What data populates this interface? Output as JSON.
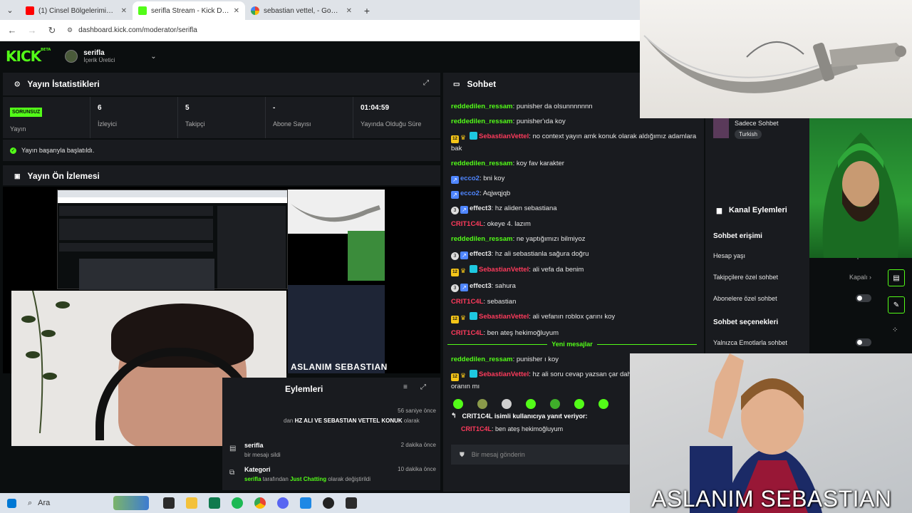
{
  "browser": {
    "tabs": [
      {
        "label": "(1) Cinsel Bölgelerimiz Neden K",
        "active": false
      },
      {
        "label": "serifla Stream - Kick Dashboard",
        "active": true
      },
      {
        "label": "sebastian vettel, - Google'da Ar",
        "active": false
      }
    ],
    "new_tab": "+",
    "url": "dashboard.kick.com/moderator/serifla"
  },
  "kick": {
    "logo": "KICK",
    "logo_badge": "BETA",
    "user_name": "serifla",
    "user_role": "İçerik Üretici"
  },
  "stats_panel": {
    "title": "Yayın İstatistikleri",
    "items": [
      {
        "value": "SORUNSUZ",
        "label": "Yayın"
      },
      {
        "value": "6",
        "label": "İzleyici"
      },
      {
        "value": "5",
        "label": "Takipçi"
      },
      {
        "value": "-",
        "label": "Abone Sayısı"
      },
      {
        "value": "01:04:59",
        "label": "Yayında Olduğu Süre"
      }
    ],
    "status_message": "Yayın başarıyla başlatıldı."
  },
  "preview_panel": {
    "title": "Yayın Ön İzlemesi",
    "caption": "ASLANIM SEBASTIAN"
  },
  "actions_panel": {
    "title": "Eylemleri",
    "rows": [
      {
        "title_pre": "dan ",
        "title_bold": "HZ ALI VE SEBASTIAN VETTEL KONUK",
        "title_post": " olarak",
        "sub": "",
        "time": "56 saniye önce"
      },
      {
        "title": "serifla",
        "sub": "bir mesajı sildi",
        "time": "2 dakika önce"
      },
      {
        "title": "Kategori",
        "sub_user": "serifla",
        "sub_mid": " tarafından ",
        "sub_cat": "Just Chatting",
        "sub_post": " olarak değiştirildi",
        "time": "10 dakika önce"
      }
    ]
  },
  "chat": {
    "title": "Sohbet",
    "messages": [
      {
        "user": "reddedilen_ressam",
        "color": "green",
        "badges": [],
        "text": "punisher da olsunnnnnnn"
      },
      {
        "user": "reddedilen_ressam",
        "color": "green",
        "badges": [],
        "text": "punisher'ıda koy"
      },
      {
        "user": "SebastianVettel",
        "color": "red",
        "badges": [
          "sub",
          "crown",
          "vip"
        ],
        "text": "no context yayın amk konuk olarak aldığımız adamlara bak"
      },
      {
        "user": "reddedilen_ressam",
        "color": "green",
        "badges": [],
        "text": "koy fav karakter"
      },
      {
        "user": "ecco2",
        "color": "blue",
        "badges": [
          "arrow"
        ],
        "text": "bni koy"
      },
      {
        "user": "ecco2",
        "color": "blue",
        "badges": [
          "arrow"
        ],
        "text": "Aqjwqjqb"
      },
      {
        "user": "effect3",
        "color": "white",
        "badges": [
          "circle",
          "arrow"
        ],
        "text": "hz aliden sebastiana"
      },
      {
        "user": "CRIT1C4L",
        "color": "red",
        "badges": [],
        "text": "okeye 4. lazım"
      },
      {
        "user": "reddedilen_ressam",
        "color": "green",
        "badges": [],
        "text": "ne yaptığımızı bilmiyoz"
      },
      {
        "user": "effect3",
        "color": "white",
        "badges": [
          "circle",
          "arrow"
        ],
        "text": "hz ali sebastianla sağura doğru"
      },
      {
        "user": "SebastianVettel",
        "color": "red",
        "badges": [
          "sub",
          "crown",
          "vip"
        ],
        "text": "ali vefa da benim"
      },
      {
        "user": "effect3",
        "color": "white",
        "badges": [
          "circle",
          "arrow"
        ],
        "text": "sahura"
      },
      {
        "user": "CRIT1C4L",
        "color": "red",
        "badges": [],
        "text": "sebastian"
      },
      {
        "user": "SebastianVettel",
        "color": "red",
        "badges": [
          "sub",
          "crown",
          "vip"
        ],
        "text": "ali vefanın roblox çarını koy"
      },
      {
        "user": "CRIT1C4L",
        "color": "red",
        "badges": [],
        "text": "ben ateş hekimoğluyum"
      }
    ],
    "new_messages_label": "Yeni mesajlar",
    "after_messages": [
      {
        "user": "reddedilen_ressam",
        "color": "green",
        "badges": [],
        "text": "punisher ı koy"
      },
      {
        "user": "SebastianVettel",
        "color": "red",
        "badges": [
          "sub",
          "crown",
          "vip"
        ],
        "text": "hz ali soru cevap yazsan çar daha yüksek ban yeme oranın mı"
      }
    ],
    "reply_header": "CRIT1C4L isimli kullanıcıya yanıt veriyor:",
    "reply_user": "CRIT1C4L",
    "reply_text": "ben ateş hekimoğluyum",
    "input_placeholder": "Bir mesaj gönderin"
  },
  "channel_panel": {
    "mode_title": "Sadece Sohbet",
    "mode_lang": "Turkish",
    "title": "Kanal Eylemleri",
    "access_title": "Sohbet erişimi",
    "settings": [
      {
        "label": "Hesap yaşı",
        "value": "Kapalı"
      },
      {
        "label": "Takipçilere özel sohbet",
        "value": "Kapalı"
      },
      {
        "label": "Abonelere özel sohbet",
        "value": ""
      }
    ],
    "options_title": "Sohbet seçenekleri",
    "options": [
      {
        "label": "Yalnızca Emotlarla sohbet"
      }
    ]
  },
  "overlay": {
    "caption": "ASLANIM SEBASTIAN"
  },
  "taskbar": {
    "search": "Ara"
  },
  "colors": {
    "accent": "#53fc18",
    "bg": "#0b0e0f",
    "panel": "#191b1f",
    "user_red": "#ff3b5c",
    "user_blue": "#4f86ff"
  }
}
